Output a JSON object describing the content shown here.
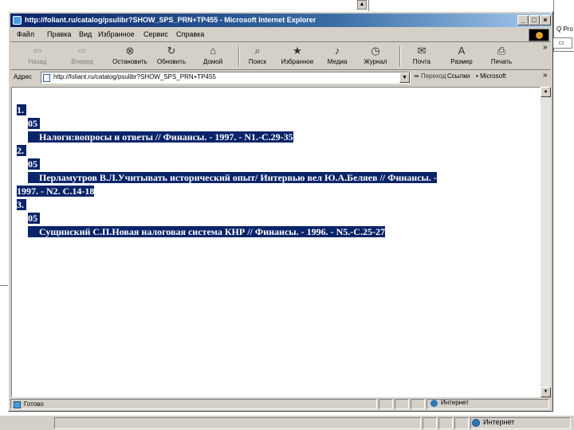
{
  "window": {
    "title": "http://foliant.ru/catalog/psulibr?SHOW_SPS_PRN+TP455 - Microsoft Internet Explorer",
    "controls": [
      "_",
      "□",
      "×"
    ]
  },
  "menu": {
    "items": [
      "Файл",
      "Правка",
      "Вид",
      "Избранное",
      "Сервис",
      "Справка"
    ]
  },
  "toolbar": {
    "buttons": [
      {
        "label": "Назад",
        "icon": "back-arrow-icon",
        "glyph": "⇦"
      },
      {
        "label": "Вперед",
        "icon": "forward-arrow-icon",
        "glyph": "⇨"
      },
      {
        "label": "Остановить",
        "icon": "stop-icon",
        "glyph": "⊗"
      },
      {
        "label": "Обновить",
        "icon": "refresh-icon",
        "glyph": "↻"
      },
      {
        "label": "Домой",
        "icon": "home-icon",
        "glyph": "⌂"
      },
      {
        "label": "Поиск",
        "icon": "search-icon",
        "glyph": "⌕"
      },
      {
        "label": "Избранное",
        "icon": "favorites-icon",
        "glyph": "★"
      },
      {
        "label": "Медиа",
        "icon": "media-icon",
        "glyph": "♪"
      },
      {
        "label": "Журнал",
        "icon": "history-icon",
        "glyph": "◷"
      },
      {
        "label": "Почта",
        "icon": "mail-icon",
        "glyph": "✉"
      },
      {
        "label": "Размер",
        "icon": "font-size-icon",
        "glyph": "A"
      },
      {
        "label": "Печать",
        "icon": "print-icon",
        "glyph": "⎙"
      }
    ],
    "more": "»"
  },
  "address": {
    "label": "Адрес",
    "value": "http://foliant.ru/catalog/psulibr?SHOW_SPS_PRN+TP455",
    "go_label": "Переход",
    "links_label": "Ссылки",
    "links_item": "Microsoft",
    "more": "»"
  },
  "records": [
    {
      "num": "1.",
      "code": "05",
      "text": "Налоги:вопросы и ответы // Финансы. - 1997. - N1.-С.29-35"
    },
    {
      "num": "2.",
      "code": "05",
      "text": "Перламутров В.Л.Учитывать исторический опыт/ Интервью вел Ю.А.Беляев // Финансы. -",
      "text2": "1997. - N2. С.14-18"
    },
    {
      "num": "3.",
      "code": "05",
      "text": "Сущинский С.П.Новая налоговая система КНР // Финансы. - 1996. - N5.-С.25-27"
    }
  ],
  "status": {
    "text": "Готово",
    "zone": "Интернет"
  },
  "background": {
    "status_zone": "Интернет",
    "right_label": "Q Pro"
  }
}
